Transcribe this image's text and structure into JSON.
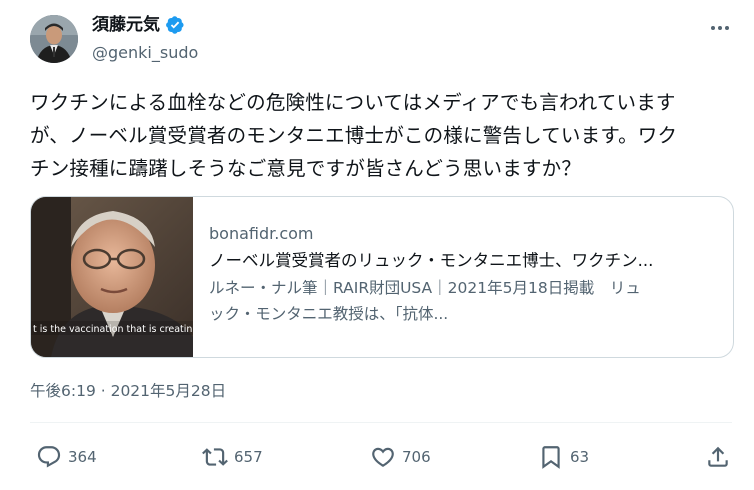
{
  "author": {
    "name": "須藤元気",
    "handle": "@genki_sudo"
  },
  "tweet": {
    "lines": [
      "ワクチンによる血栓などの危険性についてはメディアでも言われています",
      "が、ノーベル賞受賞者のモンタニエ博士がこの様に警告しています。ワク",
      "チン接種に躊躇しそうなご意見ですが皆さんどう思いますか？"
    ]
  },
  "card": {
    "domain": "bonafidr.com",
    "title": "ノーベル賞受賞者のリュック・モンタニエ博士、ワクチン...",
    "description_lines": [
      "ルネー・ナル筆｜RAIR財団USA｜2021年5月18日掲載　リュ",
      "ック・モンタニエ教授は、「抗体..."
    ],
    "image_caption": "t is the vaccination that is creating the"
  },
  "timestamp": "午後6:19 · 2021年5月28日",
  "actions": {
    "replies": "364",
    "retweets": "657",
    "likes": "706",
    "bookmarks": "63"
  },
  "icons": {
    "verified": "verified-badge-icon",
    "more": "more-options-icon",
    "reply": "reply-icon",
    "retweet": "retweet-icon",
    "like": "heart-icon",
    "bookmark": "bookmark-icon",
    "share": "share-icon"
  },
  "colors": {
    "text": "#0f1419",
    "secondary": "#536471",
    "verified": "#1d9bf0",
    "border": "#cfd9de"
  }
}
